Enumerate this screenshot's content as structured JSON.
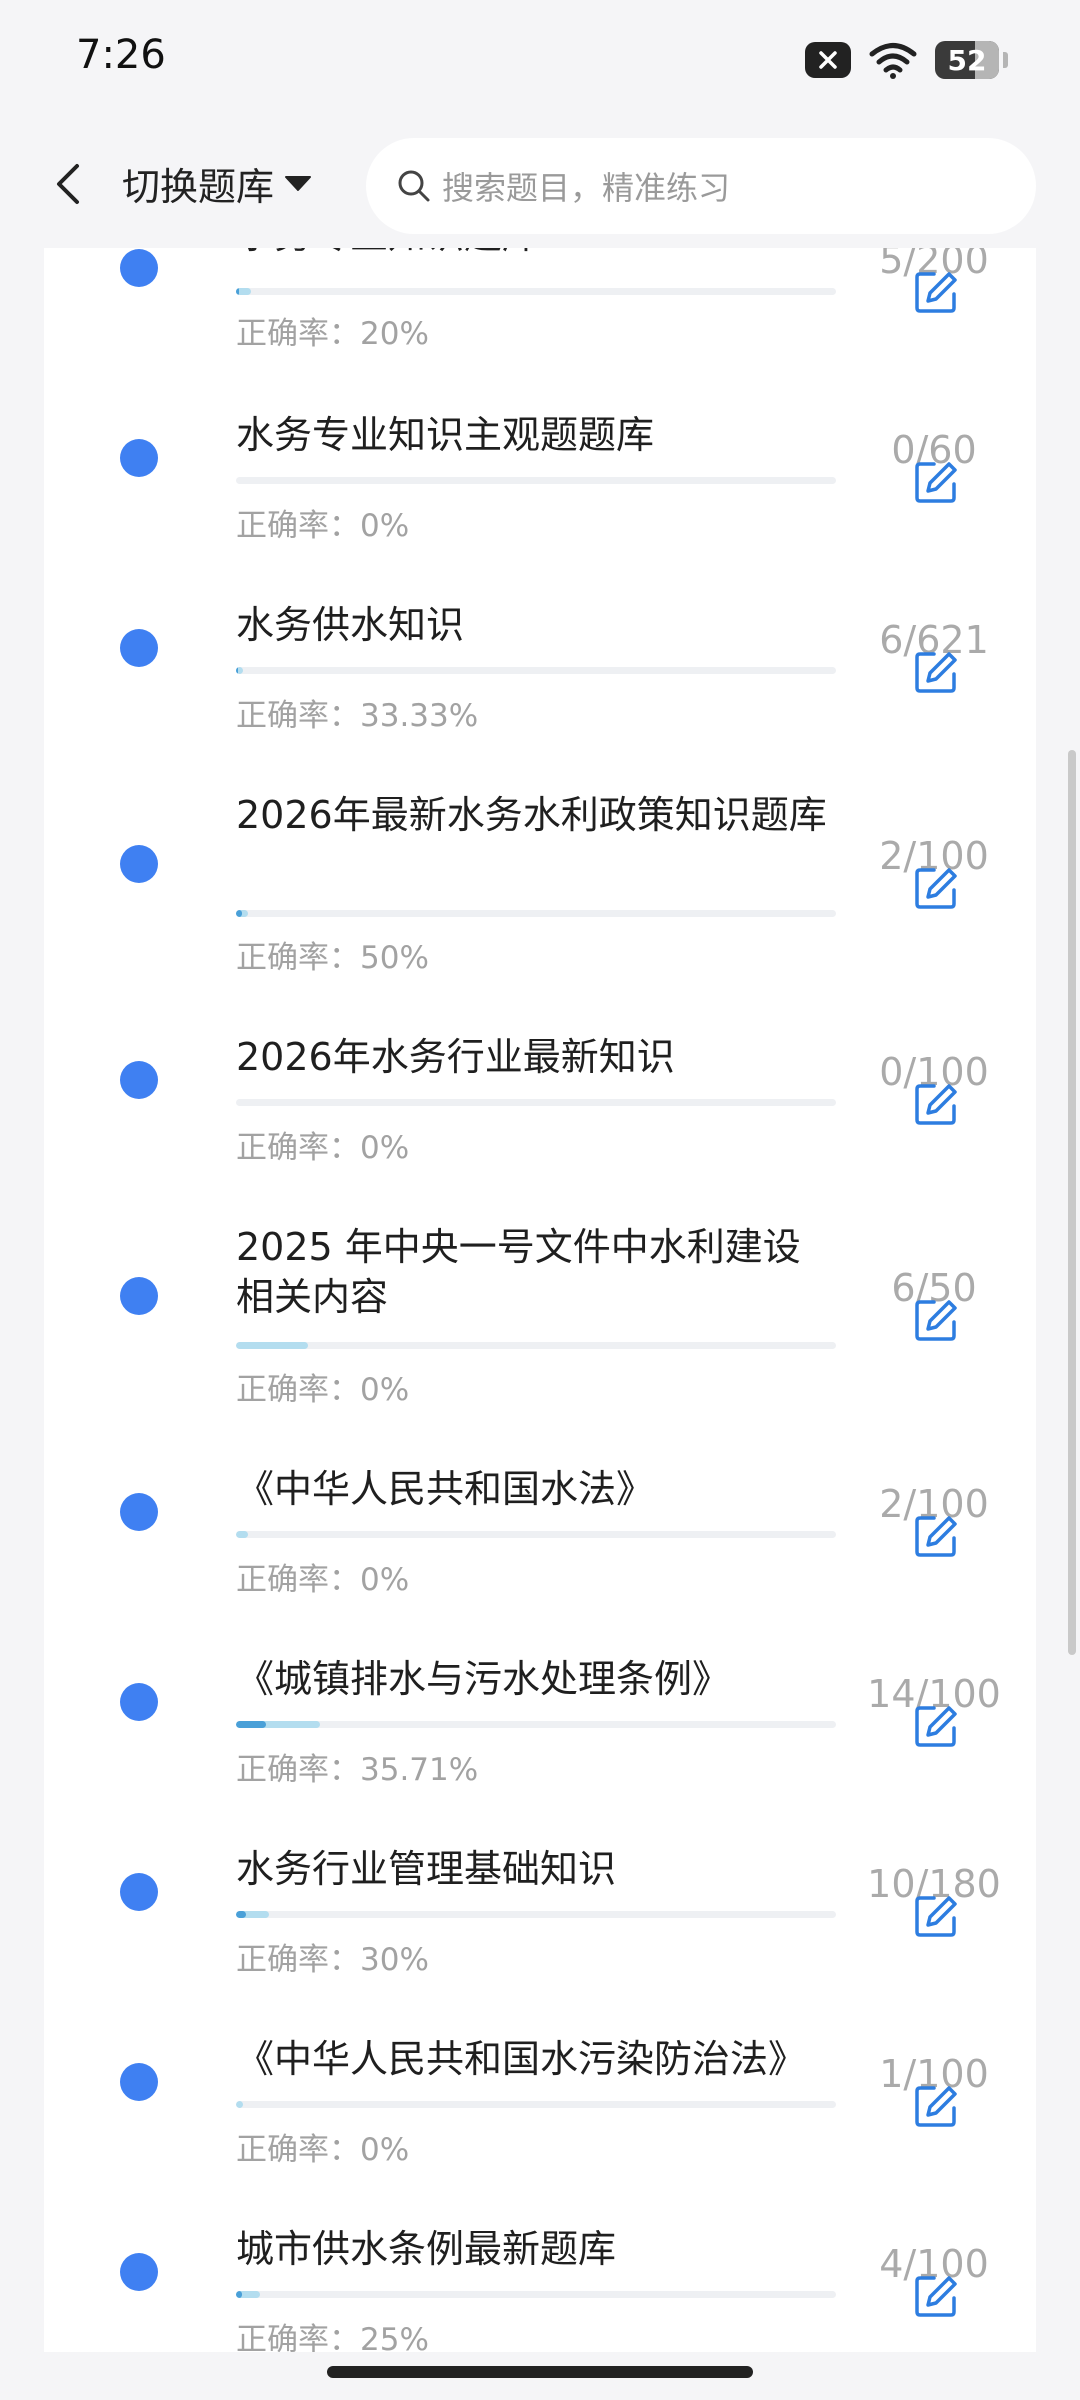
{
  "status_bar": {
    "time": "7:26",
    "battery": "52"
  },
  "header": {
    "switch_label": "切换题库",
    "search_placeholder": "搜索题目，精准练习"
  },
  "list": {
    "accuracy_prefix": "正确率：",
    "items": [
      {
        "name": "水务专业知识题库",
        "done": 5,
        "total": 200,
        "count": "5/200",
        "accuracy": "20%"
      },
      {
        "name": "水务专业知识主观题题库",
        "done": 0,
        "total": 60,
        "count": "0/60",
        "accuracy": "0%"
      },
      {
        "name": "水务供水知识",
        "done": 6,
        "total": 621,
        "count": "6/621",
        "accuracy": "33.33%"
      },
      {
        "name": "2026年最新水务水利政策知识题库",
        "done": 2,
        "total": 100,
        "count": "2/100",
        "accuracy": "50%"
      },
      {
        "name": "2026年水务行业最新知识",
        "done": 0,
        "total": 100,
        "count": "0/100",
        "accuracy": "0%"
      },
      {
        "name": "2025 年中央一号文件中水利建设相关内容",
        "done": 6,
        "total": 50,
        "count": "6/50",
        "accuracy": "0%"
      },
      {
        "name": "《中华人民共和国水法》",
        "done": 2,
        "total": 100,
        "count": "2/100",
        "accuracy": "0%"
      },
      {
        "name": "《城镇排水与污水处理条例》",
        "done": 14,
        "total": 100,
        "count": "14/100",
        "accuracy": "35.71%"
      },
      {
        "name": "水务行业管理基础知识",
        "done": 10,
        "total": 180,
        "count": "10/180",
        "accuracy": "30%"
      },
      {
        "name": "《中华人民共和国水污染防治法》",
        "done": 1,
        "total": 100,
        "count": "1/100",
        "accuracy": "0%"
      },
      {
        "name": "城市供水条例最新题库",
        "done": 4,
        "total": 100,
        "count": "4/100",
        "accuracy": "25%"
      }
    ]
  }
}
